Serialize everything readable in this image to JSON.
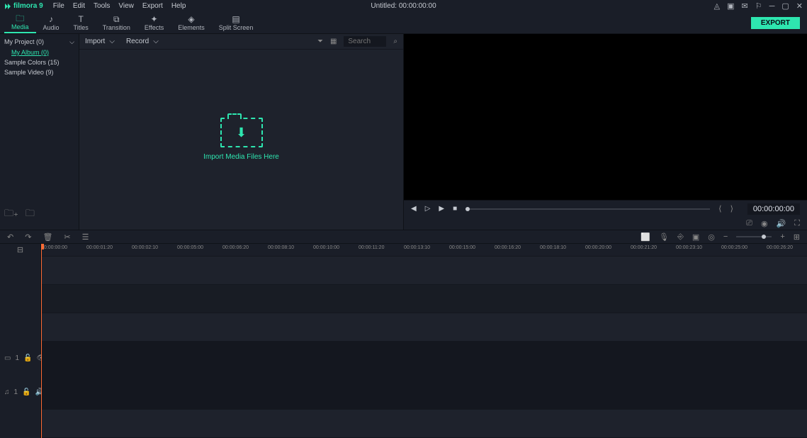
{
  "app": {
    "name": "filmora 9"
  },
  "menu": {
    "file": "File",
    "edit": "Edit",
    "tools": "Tools",
    "view": "View",
    "export": "Export",
    "help": "Help"
  },
  "title": "Untitled:  00:00:00:00",
  "tabs": {
    "media": "Media",
    "audio": "Audio",
    "titles": "Titles",
    "transition": "Transition",
    "effects": "Effects",
    "elements": "Elements",
    "split": "Split Screen"
  },
  "export_btn": "EXPORT",
  "sidebar": {
    "project": "My Project (0)",
    "album": "My Album (0)",
    "colors": "Sample Colors (15)",
    "video": "Sample Video (9)"
  },
  "media": {
    "import": "Import",
    "record": "Record",
    "search_placeholder": "Search",
    "drop_text": "Import Media Files Here"
  },
  "preview": {
    "time": "00:00:00:00"
  },
  "timeline": {
    "marks": [
      "00:00:00:00",
      "00:00:01:20",
      "00:00:02:10",
      "00:00:05:00",
      "00:00:06:20",
      "00:00:08:10",
      "00:00:10:00",
      "00:00:11:20",
      "00:00:13:10",
      "00:00:15:00",
      "00:00:16:20",
      "00:00:18:10",
      "00:00:20:00",
      "00:00:21:20",
      "00:00:23:10",
      "00:00:25:00",
      "00:00:26:20"
    ],
    "track_video": "1",
    "track_audio": "1"
  }
}
